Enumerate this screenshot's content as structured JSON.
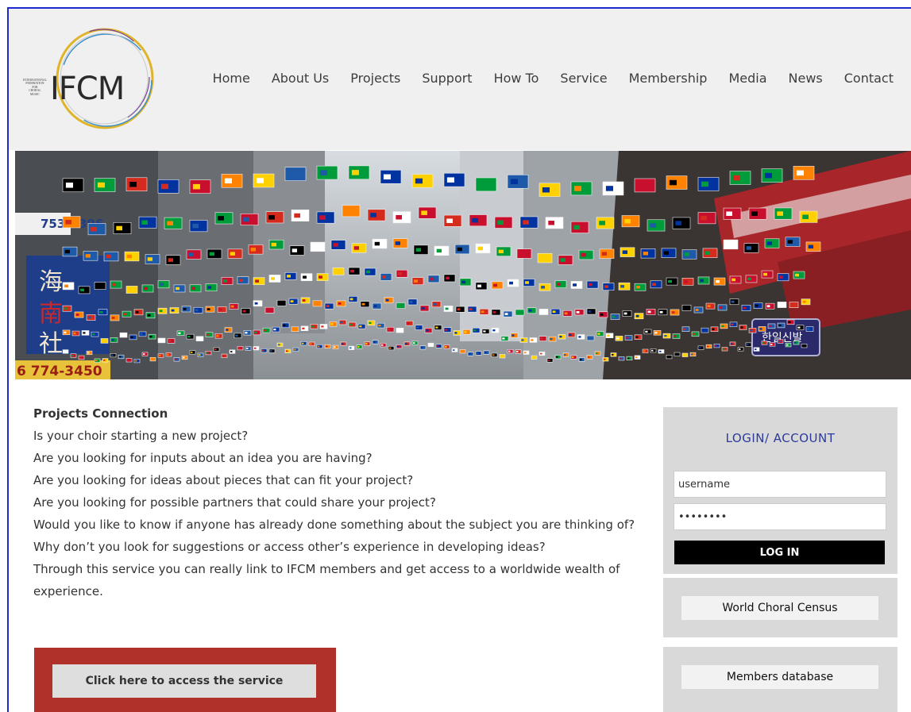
{
  "logo": {
    "small_text": [
      "INTERNATIONAL",
      "FEDERATION",
      "FOR",
      "CHORAL",
      "MUSIC"
    ],
    "main_text": "IFCM",
    "ring_colors": [
      "#e0b42a",
      "#3d8fc7",
      "#7a3f98"
    ]
  },
  "nav": {
    "items": [
      "Home",
      "About Us",
      "Projects",
      "Support",
      "How To",
      "Service",
      "Membership",
      "Media",
      "News",
      "Contact"
    ]
  },
  "hero": {
    "shop_sign_left": "753-9396",
    "shop_sign_bottom": "6 774-3450",
    "shop_sign_right": "한일신발"
  },
  "article": {
    "heading": "Projects Connection",
    "paragraphs": [
      "Is your choir starting a new project?",
      "Are you looking for inputs about an idea you are having?",
      "Are you looking for ideas about pieces that can fit your project?",
      "Are you looking for possible partners that could share your project?",
      "Would you like to know if anyone has already done something about the subject you are thinking of?",
      "Why don’t you look for suggestions or access other’s experience in developing ideas?",
      "Through this service you can really link to IFCM members and get access to a worldwide wealth of experience."
    ],
    "cta_label": "Click here to access the service"
  },
  "login": {
    "title": "LOGIN/ ACCOUNT",
    "username_value": "username",
    "password_value": "••••••••",
    "button_label": "LOG IN"
  },
  "sidebar": {
    "census_label": "World Choral Census",
    "members_label": "Members database"
  },
  "colors": {
    "frame": "#1b2bd0",
    "cta_bg": "#b0302a",
    "login_title": "#2b3a9b"
  }
}
